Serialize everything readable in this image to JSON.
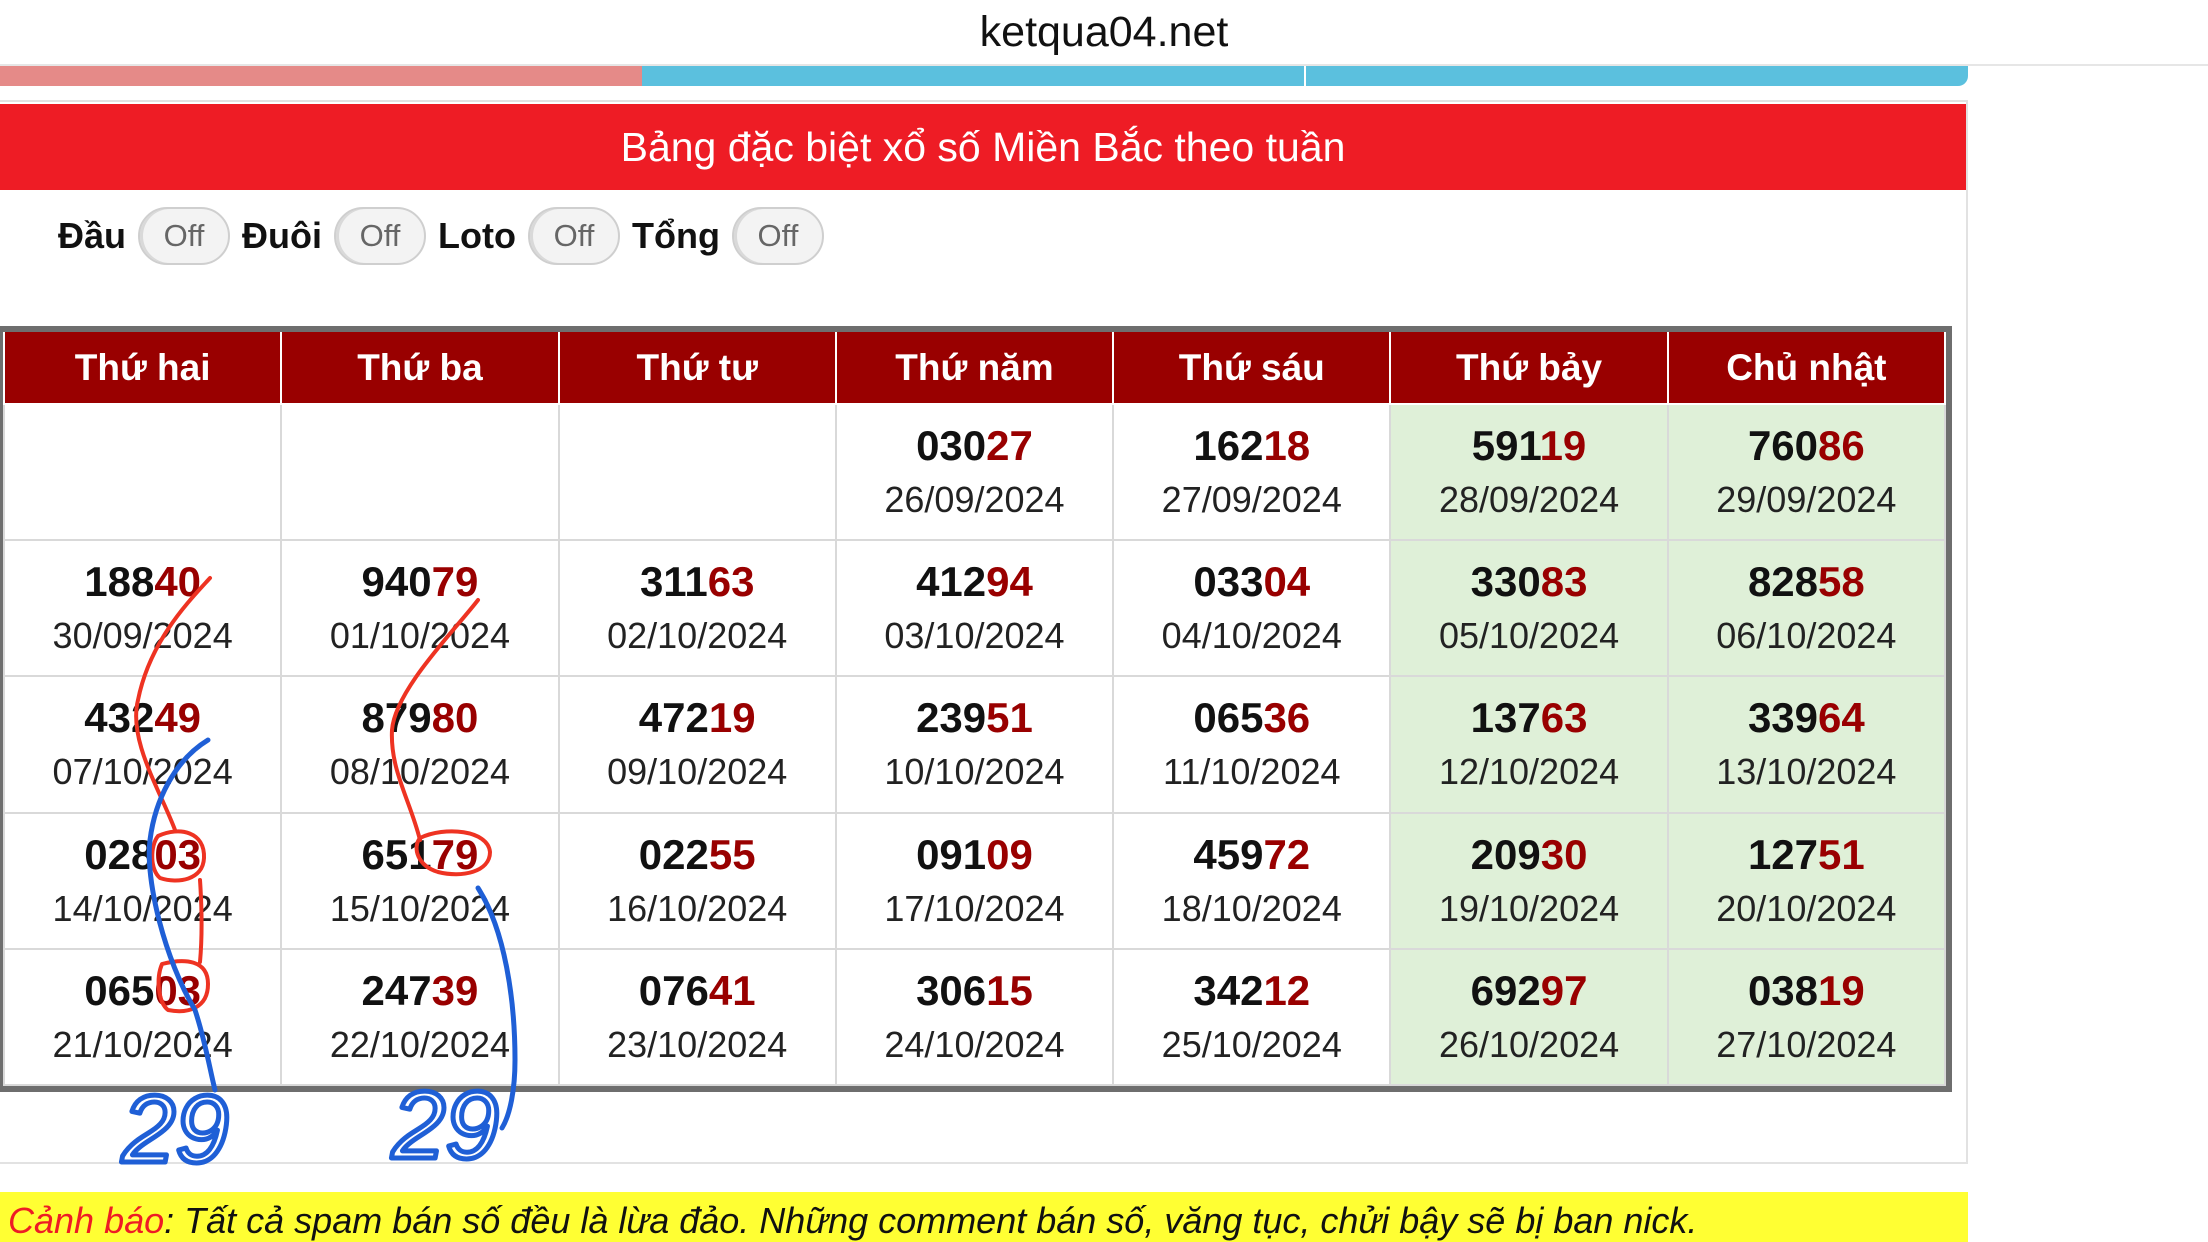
{
  "browser": {
    "url": "ketqua04.net"
  },
  "page": {
    "title": "Bảng đặc biệt xổ số Miền Bắc theo tuần",
    "toggles": [
      {
        "label": "Đầu",
        "state": "Off"
      },
      {
        "label": "Đuôi",
        "state": "Off"
      },
      {
        "label": "Loto",
        "state": "Off"
      },
      {
        "label": "Tổng",
        "state": "Off"
      }
    ],
    "table": {
      "headers": [
        "Thứ hai",
        "Thứ ba",
        "Thứ tư",
        "Thứ năm",
        "Thứ sáu",
        "Thứ bảy",
        "Chủ nhật"
      ],
      "rows": [
        [
          null,
          null,
          null,
          {
            "head": "030",
            "tail": "27",
            "date": "26/09/2024"
          },
          {
            "head": "162",
            "tail": "18",
            "date": "27/09/2024"
          },
          {
            "head": "591",
            "tail": "19",
            "date": "28/09/2024"
          },
          {
            "head": "760",
            "tail": "86",
            "date": "29/09/2024"
          }
        ],
        [
          {
            "head": "188",
            "tail": "40",
            "date": "30/09/2024"
          },
          {
            "head": "940",
            "tail": "79",
            "date": "01/10/2024"
          },
          {
            "head": "311",
            "tail": "63",
            "date": "02/10/2024"
          },
          {
            "head": "412",
            "tail": "94",
            "date": "03/10/2024"
          },
          {
            "head": "033",
            "tail": "04",
            "date": "04/10/2024"
          },
          {
            "head": "330",
            "tail": "83",
            "date": "05/10/2024"
          },
          {
            "head": "828",
            "tail": "58",
            "date": "06/10/2024"
          }
        ],
        [
          {
            "head": "432",
            "tail": "49",
            "date": "07/10/2024"
          },
          {
            "head": "879",
            "tail": "80",
            "date": "08/10/2024"
          },
          {
            "head": "472",
            "tail": "19",
            "date": "09/10/2024"
          },
          {
            "head": "239",
            "tail": "51",
            "date": "10/10/2024"
          },
          {
            "head": "065",
            "tail": "36",
            "date": "11/10/2024"
          },
          {
            "head": "137",
            "tail": "63",
            "date": "12/10/2024"
          },
          {
            "head": "339",
            "tail": "64",
            "date": "13/10/2024"
          }
        ],
        [
          {
            "head": "028",
            "tail": "03",
            "date": "14/10/2024"
          },
          {
            "head": "651",
            "tail": "79",
            "date": "15/10/2024"
          },
          {
            "head": "022",
            "tail": "55",
            "date": "16/10/2024"
          },
          {
            "head": "091",
            "tail": "09",
            "date": "17/10/2024"
          },
          {
            "head": "459",
            "tail": "72",
            "date": "18/10/2024"
          },
          {
            "head": "209",
            "tail": "30",
            "date": "19/10/2024"
          },
          {
            "head": "127",
            "tail": "51",
            "date": "20/10/2024"
          }
        ],
        [
          {
            "head": "065",
            "tail": "03",
            "date": "21/10/2024"
          },
          {
            "head": "247",
            "tail": "39",
            "date": "22/10/2024"
          },
          {
            "head": "076",
            "tail": "41",
            "date": "23/10/2024"
          },
          {
            "head": "306",
            "tail": "15",
            "date": "24/10/2024"
          },
          {
            "head": "342",
            "tail": "12",
            "date": "25/10/2024"
          },
          {
            "head": "692",
            "tail": "97",
            "date": "26/10/2024"
          },
          {
            "head": "038",
            "tail": "19",
            "date": "27/10/2024"
          }
        ]
      ]
    },
    "annotations": {
      "left_sum": "29",
      "right_sum": "29"
    },
    "warning": {
      "prefix": "Cảnh báo",
      "text": ": Tất cả spam bán số đều là lừa đảo. Những comment bán số, văng tục, chửi bậy sẽ bị ban nick."
    }
  },
  "colors": {
    "banner": "#ee1c25",
    "header": "#990000",
    "weekend": "#dff0d8",
    "tail": "#990000",
    "warning_bg": "#ffff33",
    "ink_red": "#ee3322",
    "ink_blue": "#1f5fd6"
  }
}
